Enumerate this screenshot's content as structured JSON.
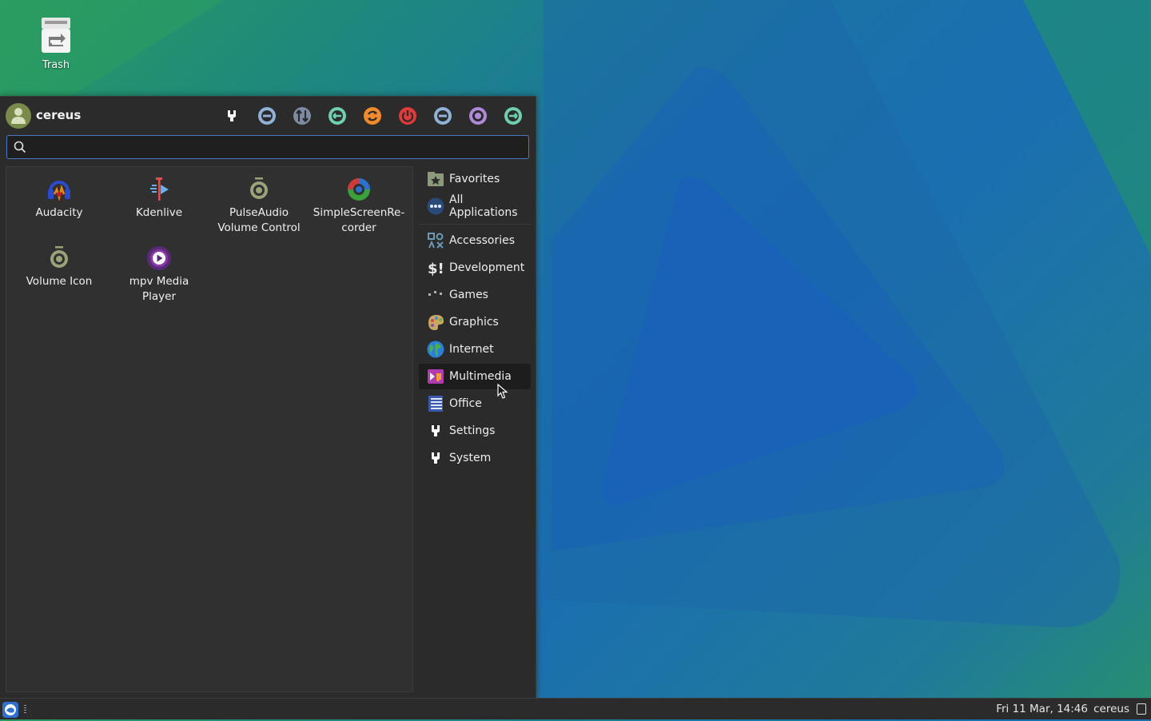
{
  "desktop": {
    "trash_label": "Trash"
  },
  "menu": {
    "username": "cereus",
    "search": {
      "value": "",
      "placeholder": ""
    },
    "actions": [
      {
        "name": "settings-manager-icon",
        "color": "#ffffff"
      },
      {
        "name": "lock-screen-icon",
        "color": "#8fb2d6"
      },
      {
        "name": "switch-user-icon",
        "color": "#8fa0b8"
      },
      {
        "name": "log-out-icon",
        "color": "#6fd0b0"
      },
      {
        "name": "restart-icon",
        "color": "#f08a2a"
      },
      {
        "name": "shutdown-icon",
        "color": "#e03a3a"
      },
      {
        "name": "suspend-icon",
        "color": "#8fb2d6"
      },
      {
        "name": "hibernate-icon",
        "color": "#b08ad8"
      },
      {
        "name": "exit-icon",
        "color": "#6fd0b0"
      }
    ],
    "apps": [
      {
        "label": "Audacity",
        "icon": "audacity-icon"
      },
      {
        "label": "Kdenlive",
        "icon": "kdenlive-icon"
      },
      {
        "label": "PulseAudio Volume Control",
        "icon": "pulseaudio-icon"
      },
      {
        "label": "SimpleScreenRe-corder",
        "icon": "simplescreenrecorder-icon"
      },
      {
        "label": "Volume Icon",
        "icon": "volume-icon"
      },
      {
        "label": "mpv Media Player",
        "icon": "mpv-icon"
      }
    ],
    "categories": [
      {
        "label": "Favorites",
        "icon": "favorites-icon"
      },
      {
        "label": "All Applications",
        "icon": "all-applications-icon"
      },
      {
        "label": "Accessories",
        "icon": "accessories-icon"
      },
      {
        "label": "Development",
        "icon": "development-icon"
      },
      {
        "label": "Games",
        "icon": "games-icon"
      },
      {
        "label": "Graphics",
        "icon": "graphics-icon"
      },
      {
        "label": "Internet",
        "icon": "internet-icon"
      },
      {
        "label": "Multimedia",
        "icon": "multimedia-icon",
        "active": true
      },
      {
        "label": "Office",
        "icon": "office-icon"
      },
      {
        "label": "Settings",
        "icon": "settings-icon"
      },
      {
        "label": "System",
        "icon": "system-icon"
      }
    ]
  },
  "taskbar": {
    "clock": "Fri 11 Mar, 14:46",
    "user": "cereus"
  }
}
